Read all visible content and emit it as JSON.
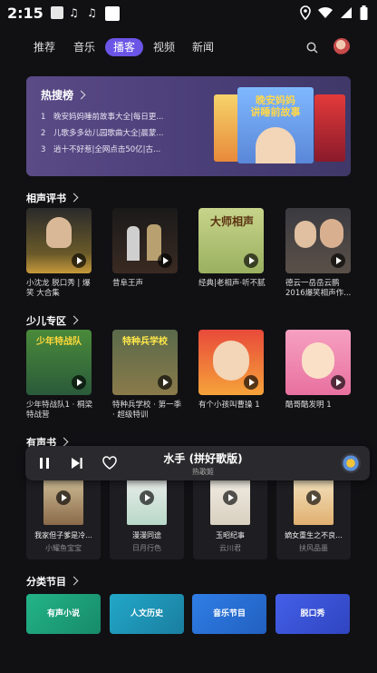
{
  "status_bar": {
    "time": "2:15",
    "notification_icons": [
      "a-app-icon",
      "music-note-icon",
      "music-note-icon",
      "square-app-icon"
    ],
    "right_icons": [
      "location-icon",
      "wifi-icon",
      "signal-icon",
      "battery-icon"
    ]
  },
  "nav": {
    "tabs": [
      "推荐",
      "音乐",
      "播客",
      "视频",
      "新闻"
    ],
    "active_tab": "播客"
  },
  "hot": {
    "title": "热搜榜",
    "items": [
      {
        "num": "1",
        "text": "晚安妈妈睡前故事大全|每日更..."
      },
      {
        "num": "2",
        "text": "儿歌多多幼儿园歌曲大全|晨蒙..."
      },
      {
        "num": "3",
        "text": "逍十不好惹|全网点击50亿|古..."
      }
    ],
    "cover_title": "晚安妈妈\n讲睡前故事"
  },
  "sections": {
    "crosstalk": {
      "title": "相声评书",
      "items": [
        {
          "caption": "小沈龙 脱口秀 | 爆笑 大合集"
        },
        {
          "caption": "昔阜王声"
        },
        {
          "caption": "经典|老相声·听不腻"
        },
        {
          "caption": "德云一岳岳云鹏2016爆笑相声作..."
        }
      ],
      "thumb_text": [
        "",
        "",
        "大师相声",
        ""
      ]
    },
    "kids": {
      "title": "少儿专区",
      "items": [
        {
          "caption": "少年特战队1 · 桐梁特战营"
        },
        {
          "caption": "特种兵学校 · 第一季 · 超级特训"
        },
        {
          "caption": "有个小孩叫曹操 1"
        },
        {
          "caption": "酷哥酷发明 1"
        }
      ],
      "thumb_text": [
        "少年特战队",
        "特种兵学校",
        "",
        ""
      ]
    },
    "audiobooks": {
      "title": "有声书",
      "items": [
        {
          "title": "我家但子爹是冷...",
          "author": "小耀鱼宝宝"
        },
        {
          "title": "漫漫同途",
          "author": "日月行色"
        },
        {
          "title": "玉昭纪事",
          "author": "云川君"
        },
        {
          "title": "嫡女重生之不良...",
          "author": "扶风品墨"
        }
      ]
    },
    "categories": {
      "title": "分类节目",
      "items": [
        {
          "label": "有声小说",
          "color": "#1fa37c"
        },
        {
          "label": "人文历史",
          "color": "#1e94b8"
        },
        {
          "label": "音乐节目",
          "color": "#2a6fd6"
        },
        {
          "label": "脱口秀",
          "color": "#3a56d8"
        }
      ]
    }
  },
  "player": {
    "title": "水手 (拼好歌版)",
    "artist": "热歌姬"
  },
  "colors": {
    "accent": "#6a55e6",
    "background": "#111114"
  }
}
